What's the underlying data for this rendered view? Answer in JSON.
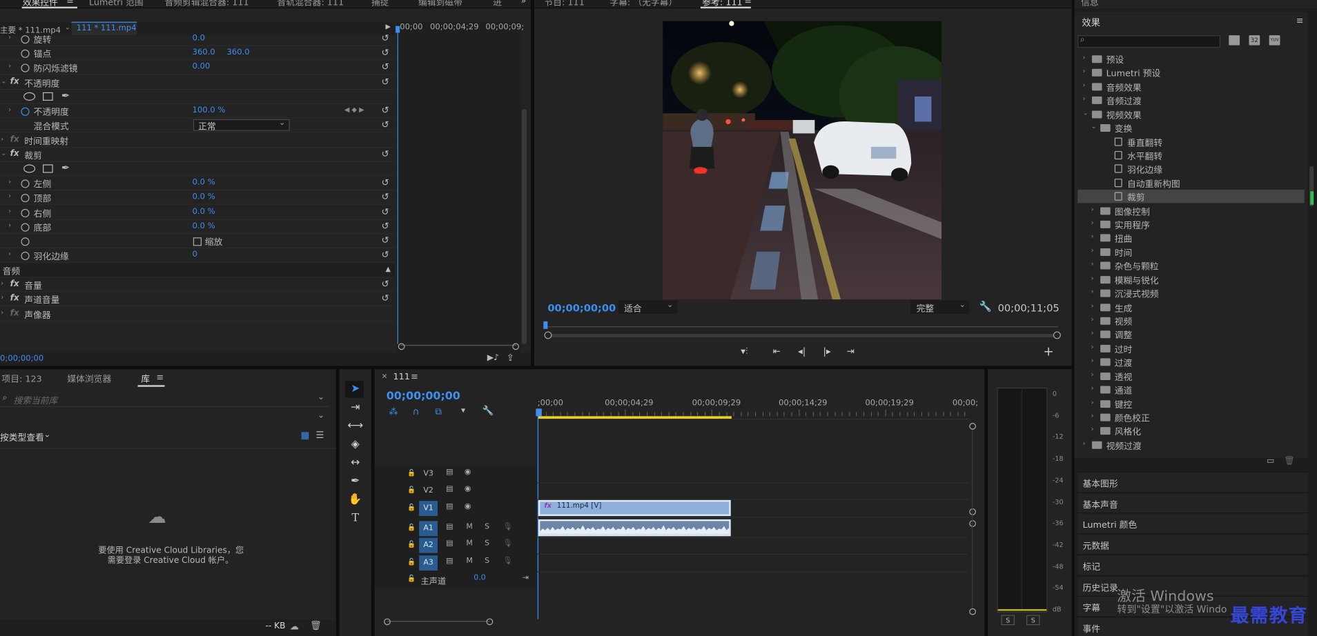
{
  "effect_controls": {
    "tabs": [
      "效果控件",
      "Lumetri 范围",
      "音频剪辑混合器: 111",
      "音轨混合器: 111",
      "捕捉",
      "编辑到磁带",
      "进"
    ],
    "menu_icon": "hamburger-icon",
    "more_icon": "double-chevron-right-icon",
    "clip_master": "主要 * 111.mp4",
    "clip_sequence": "111 * 111.mp4",
    "mini_ruler": [
      "00;00",
      "00;00;04;29",
      "00;00;09;"
    ],
    "rows": {
      "rotation": {
        "label": "旋转",
        "value": "0.0"
      },
      "anchor": {
        "label": "锚点",
        "x": "360.0",
        "y": "360.0"
      },
      "antiflicker": {
        "label": "防闪烁滤镜",
        "value": "0.00"
      },
      "opacity_group": {
        "label": "不透明度"
      },
      "opacity": {
        "label": "不透明度",
        "value": "100.0 %"
      },
      "blend": {
        "label": "混合模式",
        "value": "正常"
      },
      "time_remap": {
        "label": "时间重映射"
      },
      "crop_group": {
        "label": "裁剪"
      },
      "left": {
        "label": "左侧",
        "value": "0.0 %"
      },
      "top": {
        "label": "顶部",
        "value": "0.0 %"
      },
      "right": {
        "label": "右侧",
        "value": "0.0 %"
      },
      "bottom": {
        "label": "底部",
        "value": "0.0 %"
      },
      "zoom": {
        "label": "缩放"
      },
      "feather": {
        "label": "羽化边缘",
        "value": "0"
      },
      "audio_header": {
        "label": "音频"
      },
      "volume": {
        "label": "音量"
      },
      "channel_volume": {
        "label": "声道音量"
      },
      "panner": {
        "label": "声像器"
      }
    },
    "current_time": "0;00;00;00"
  },
  "program_monitor": {
    "tabs": [
      "节目: 111",
      "字幕: （无字幕）",
      "参考: 111"
    ],
    "timecode": "00;00;00;00",
    "fit": "适合",
    "quality": "完整",
    "duration": "00;00;11;05"
  },
  "effects_panel": {
    "top_label": "信息",
    "title": "效果",
    "search_placeholder": "",
    "badges": [
      "32",
      "YUV"
    ],
    "tree": [
      {
        "label": "预设",
        "level": 0,
        "kind": "folder",
        "open": false
      },
      {
        "label": "Lumetri 预设",
        "level": 0,
        "kind": "folder",
        "open": false
      },
      {
        "label": "音频效果",
        "level": 0,
        "kind": "folder",
        "open": false
      },
      {
        "label": "音频过渡",
        "level": 0,
        "kind": "folder",
        "open": false
      },
      {
        "label": "视频效果",
        "level": 0,
        "kind": "folder",
        "open": true
      },
      {
        "label": "变换",
        "level": 1,
        "kind": "folder",
        "open": true
      },
      {
        "label": "垂直翻转",
        "level": 2,
        "kind": "effect"
      },
      {
        "label": "水平翻转",
        "level": 2,
        "kind": "effect"
      },
      {
        "label": "羽化边缘",
        "level": 2,
        "kind": "effect"
      },
      {
        "label": "自动重新构图",
        "level": 2,
        "kind": "effect"
      },
      {
        "label": "裁剪",
        "level": 2,
        "kind": "effect",
        "selected": true
      },
      {
        "label": "图像控制",
        "level": 1,
        "kind": "folder",
        "open": false
      },
      {
        "label": "实用程序",
        "level": 1,
        "kind": "folder",
        "open": false
      },
      {
        "label": "扭曲",
        "level": 1,
        "kind": "folder",
        "open": false
      },
      {
        "label": "时间",
        "level": 1,
        "kind": "folder",
        "open": false
      },
      {
        "label": "杂色与颗粒",
        "level": 1,
        "kind": "folder",
        "open": false
      },
      {
        "label": "模糊与锐化",
        "level": 1,
        "kind": "folder",
        "open": false
      },
      {
        "label": "沉浸式视频",
        "level": 1,
        "kind": "folder",
        "open": false
      },
      {
        "label": "生成",
        "level": 1,
        "kind": "folder",
        "open": false
      },
      {
        "label": "视频",
        "level": 1,
        "kind": "folder",
        "open": false
      },
      {
        "label": "调整",
        "level": 1,
        "kind": "folder",
        "open": false
      },
      {
        "label": "过时",
        "level": 1,
        "kind": "folder",
        "open": false
      },
      {
        "label": "过渡",
        "level": 1,
        "kind": "folder",
        "open": false
      },
      {
        "label": "透视",
        "level": 1,
        "kind": "folder",
        "open": false
      },
      {
        "label": "通道",
        "level": 1,
        "kind": "folder",
        "open": false
      },
      {
        "label": "键控",
        "level": 1,
        "kind": "folder",
        "open": false
      },
      {
        "label": "颜色校正",
        "level": 1,
        "kind": "folder",
        "open": false
      },
      {
        "label": "风格化",
        "level": 1,
        "kind": "folder",
        "open": false
      },
      {
        "label": "视频过渡",
        "level": 0,
        "kind": "folder",
        "open": false
      }
    ],
    "side_panels": [
      "基本图形",
      "基本声音",
      "Lumetri 颜色",
      "元数据",
      "标记",
      "历史记录",
      "字幕",
      "事件"
    ]
  },
  "project_panel": {
    "tabs": [
      "项目: 123",
      "媒体浏览器",
      "库"
    ],
    "search_placeholder": "搜索当前库",
    "view_by": "按类型查看",
    "cc_message_line1": "要使用 Creative Cloud Libraries，您",
    "cc_message_line2": "需要登录 Creative Cloud 帐户。",
    "storage": "-- KB"
  },
  "timeline": {
    "sequence_name": "111",
    "timecode": "00;00;00;00",
    "ruler": [
      ";00;00",
      "00;00;04;29",
      "00;00;09;29",
      "00;00;14;29",
      "00;00;19;29",
      "00;00;"
    ],
    "video_tracks": [
      "V3",
      "V2",
      "V1"
    ],
    "audio_tracks": [
      "A1",
      "A2",
      "A3"
    ],
    "track_m": "M",
    "track_s": "S",
    "master": {
      "label": "主声道",
      "value": "0.0"
    },
    "clip_video": "111.mp4 [V]",
    "clip_fx": "fx"
  },
  "audio_meter": {
    "labels": [
      "0",
      "-6",
      "-12",
      "-18",
      "-24",
      "-30",
      "-36",
      "-42",
      "-48",
      "-54",
      "dB"
    ],
    "solo": [
      "S",
      "S"
    ]
  },
  "overlays": {
    "activate_title": "激活 Windows",
    "activate_sub": "转到\"设置\"以激活 Windo",
    "watermark": "最需教育"
  },
  "colors": {
    "accent": "#3d8ff0",
    "panel": "#232323",
    "clip_video": "#8fb0dc",
    "selection": "#444444"
  }
}
